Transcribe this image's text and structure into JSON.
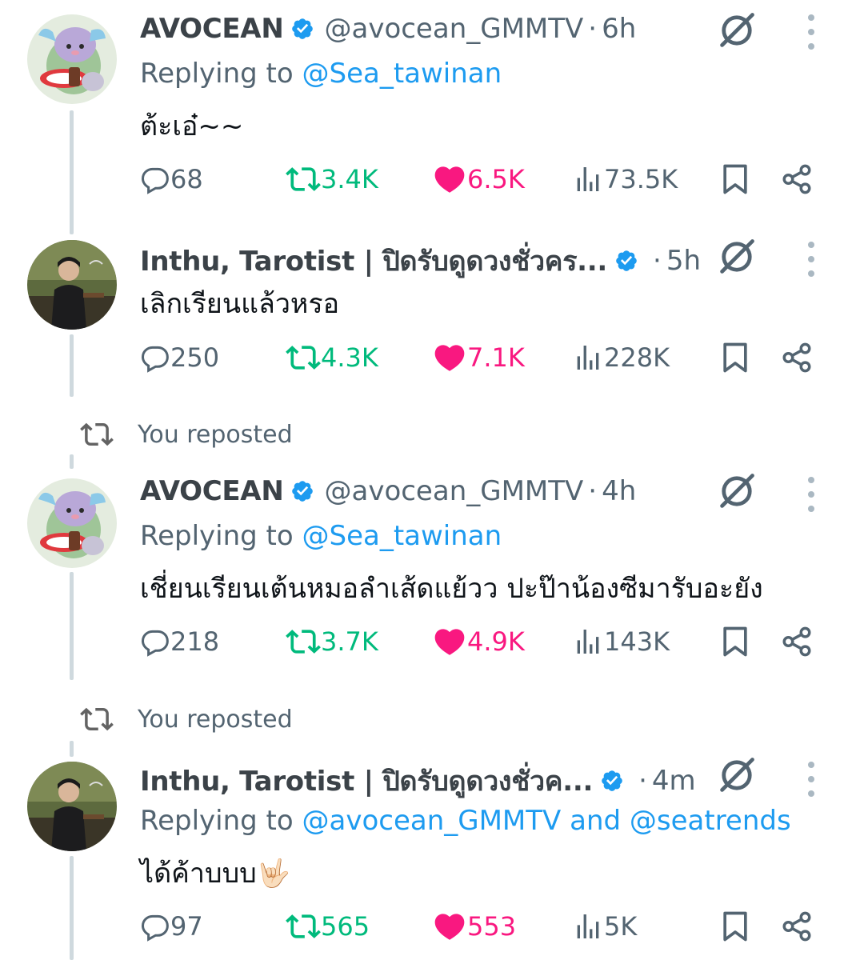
{
  "tweets": [
    {
      "name": "AVOCEAN",
      "handle": "@avocean_GMMTV",
      "time": "6h",
      "replying_prefix": "Replying to",
      "replying_to": "@Sea_tawinan",
      "text": "ต้ะเอ๋~~",
      "replies": "68",
      "reposts": "3.4K",
      "likes": "6.5K",
      "views": "73.5K"
    },
    {
      "name": "Inthu, Tarotist | ปิดรับดูดวงชั่วคร...",
      "time": "5h",
      "text": "เลิกเรียนแล้วหรอ",
      "replies": "250",
      "reposts": "4.3K",
      "likes": "7.1K",
      "views": "228K"
    },
    {
      "reposted_label": "You reposted",
      "name": "AVOCEAN",
      "handle": "@avocean_GMMTV",
      "time": "4h",
      "replying_prefix": "Replying to",
      "replying_to": "@Sea_tawinan",
      "text": "เชี่ยนเรียนเต้นหมอลำเส้ดแย้วว ปะป๊าน้องซีมารับอะยัง",
      "replies": "218",
      "reposts": "3.7K",
      "likes": "4.9K",
      "views": "143K"
    },
    {
      "reposted_label": "You reposted",
      "name": "Inthu, Tarotist | ปิดรับดูดวงชั่วค...",
      "time": "4m",
      "replying_prefix": "Replying to",
      "replying_to": "@avocean_GMMTV",
      "replying_and": "and",
      "replying_to_2": "@seatrends",
      "text": "ได้ค้าบบบ🤟🏻",
      "replies": "97",
      "reposts": "565",
      "likes": "553",
      "views": "5K"
    }
  ],
  "icons": {
    "reply": "reply-bubble-icon",
    "repost": "repost-icon",
    "like": "heart-icon",
    "views": "views-bars-icon",
    "bookmark": "bookmark-icon",
    "share": "share-icon",
    "grok": "grok-icon",
    "more": "more-vertical-icon",
    "verified": "verified-badge-icon"
  },
  "colors": {
    "link": "#1d9bf0",
    "repost": "#00ba7c",
    "like": "#f91880",
    "muted": "#536471",
    "thread_line": "#cfd9de"
  }
}
